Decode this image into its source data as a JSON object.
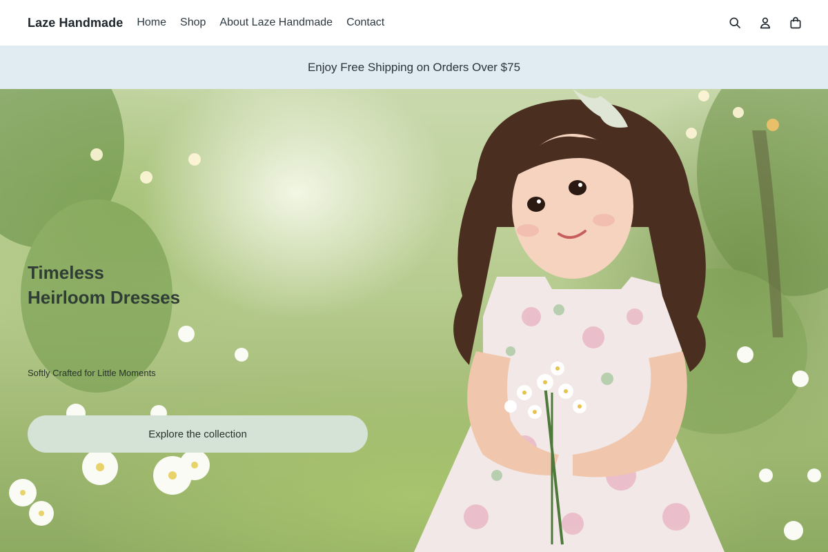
{
  "header": {
    "brand": "Laze Handmade",
    "nav": [
      {
        "label": "Home"
      },
      {
        "label": "Shop"
      },
      {
        "label": "About Laze Handmade"
      },
      {
        "label": "Contact"
      }
    ],
    "icons": [
      "search-icon",
      "account-icon",
      "cart-icon"
    ]
  },
  "announcement": {
    "text": "Enjoy Free Shipping on Orders Over $75"
  },
  "hero": {
    "title_line1": "Timeless",
    "title_line2": "Heirloom Dresses",
    "subtitle": "Softly Crafted for Little Moments",
    "cta_label": "Explore the collection",
    "image_subject": "girl-in-floral-dress-photo"
  },
  "colors": {
    "announcement_bg": "#e0ecf2",
    "cta_bg": "#d5e2d6",
    "text_dark": "#1c252b"
  }
}
